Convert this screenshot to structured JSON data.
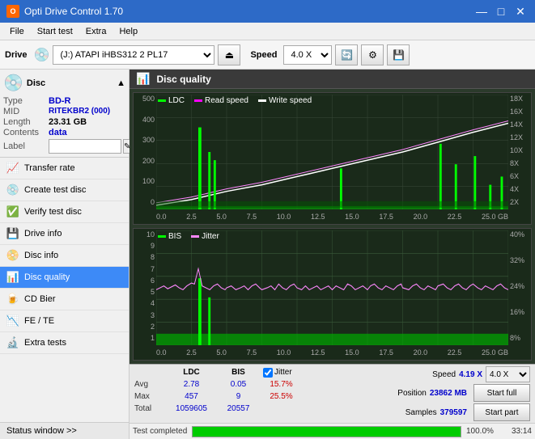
{
  "titleBar": {
    "title": "Opti Drive Control 1.70",
    "controls": [
      "minimize",
      "maximize",
      "close"
    ]
  },
  "menuBar": {
    "items": [
      "File",
      "Start test",
      "Extra",
      "Help"
    ]
  },
  "toolbar": {
    "drive_label": "Drive",
    "drive_value": "(J:)  ATAPI iHBS312  2 PL17",
    "speed_label": "Speed",
    "speed_value": "4.0 X"
  },
  "sidebar": {
    "disc_section": {
      "type_label": "Type",
      "type_value": "BD-R",
      "mid_label": "MID",
      "mid_value": "RITEKBR2 (000)",
      "length_label": "Length",
      "length_value": "23.31 GB",
      "contents_label": "Contents",
      "contents_value": "data",
      "label_label": "Label"
    },
    "nav_items": [
      {
        "id": "transfer-rate",
        "label": "Transfer rate",
        "icon": "📈"
      },
      {
        "id": "create-test-disc",
        "label": "Create test disc",
        "icon": "💿"
      },
      {
        "id": "verify-test-disc",
        "label": "Verify test disc",
        "icon": "✅"
      },
      {
        "id": "drive-info",
        "label": "Drive info",
        "icon": "💾"
      },
      {
        "id": "disc-info",
        "label": "Disc info",
        "icon": "📀"
      },
      {
        "id": "disc-quality",
        "label": "Disc quality",
        "icon": "📊",
        "active": true
      },
      {
        "id": "cd-bier",
        "label": "CD Bier",
        "icon": "🍺"
      },
      {
        "id": "fe-te",
        "label": "FE / TE",
        "icon": "📉"
      },
      {
        "id": "extra-tests",
        "label": "Extra tests",
        "icon": "🔬"
      }
    ],
    "status_window": "Status window >>"
  },
  "quality_panel": {
    "title": "Disc quality",
    "legend": {
      "ldc": "LDC",
      "read_speed": "Read speed",
      "write_speed": "Write speed"
    },
    "legend2": {
      "bis": "BIS",
      "jitter": "Jitter"
    },
    "chart1": {
      "y_left": [
        "500",
        "400",
        "300",
        "200",
        "100",
        "0"
      ],
      "y_right": [
        "18X",
        "16X",
        "14X",
        "12X",
        "10X",
        "8X",
        "6X",
        "4X",
        "2X"
      ],
      "x_axis": [
        "0.0",
        "2.5",
        "5.0",
        "7.5",
        "10.0",
        "12.5",
        "15.0",
        "17.5",
        "20.0",
        "22.5",
        "25.0 GB"
      ]
    },
    "chart2": {
      "y_left": [
        "10",
        "9",
        "8",
        "7",
        "6",
        "5",
        "4",
        "3",
        "2",
        "1"
      ],
      "y_right": [
        "40%",
        "32%",
        "24%",
        "16%",
        "8%"
      ],
      "x_axis": [
        "0.0",
        "2.5",
        "5.0",
        "7.5",
        "10.0",
        "12.5",
        "15.0",
        "17.5",
        "20.0",
        "22.5",
        "25.0 GB"
      ]
    }
  },
  "stats": {
    "headers": {
      "ldc": "LDC",
      "bis": "BIS",
      "jitter_label": "Jitter",
      "jitter_checked": true
    },
    "avg": {
      "label": "Avg",
      "ldc": "2.78",
      "bis": "0.05",
      "jitter": "15.7%"
    },
    "max": {
      "label": "Max",
      "ldc": "457",
      "bis": "9",
      "jitter": "25.5%"
    },
    "total": {
      "label": "Total",
      "ldc": "1059605",
      "bis": "20557"
    },
    "speed_label": "Speed",
    "speed_value": "4.19 X",
    "speed_select": "4.0 X",
    "position_label": "Position",
    "position_value": "23862 MB",
    "samples_label": "Samples",
    "samples_value": "379597",
    "btn_start_full": "Start full",
    "btn_start_part": "Start part"
  },
  "progress": {
    "status": "Test completed",
    "percent": 100,
    "percent_text": "100.0%",
    "time": "33:14"
  }
}
